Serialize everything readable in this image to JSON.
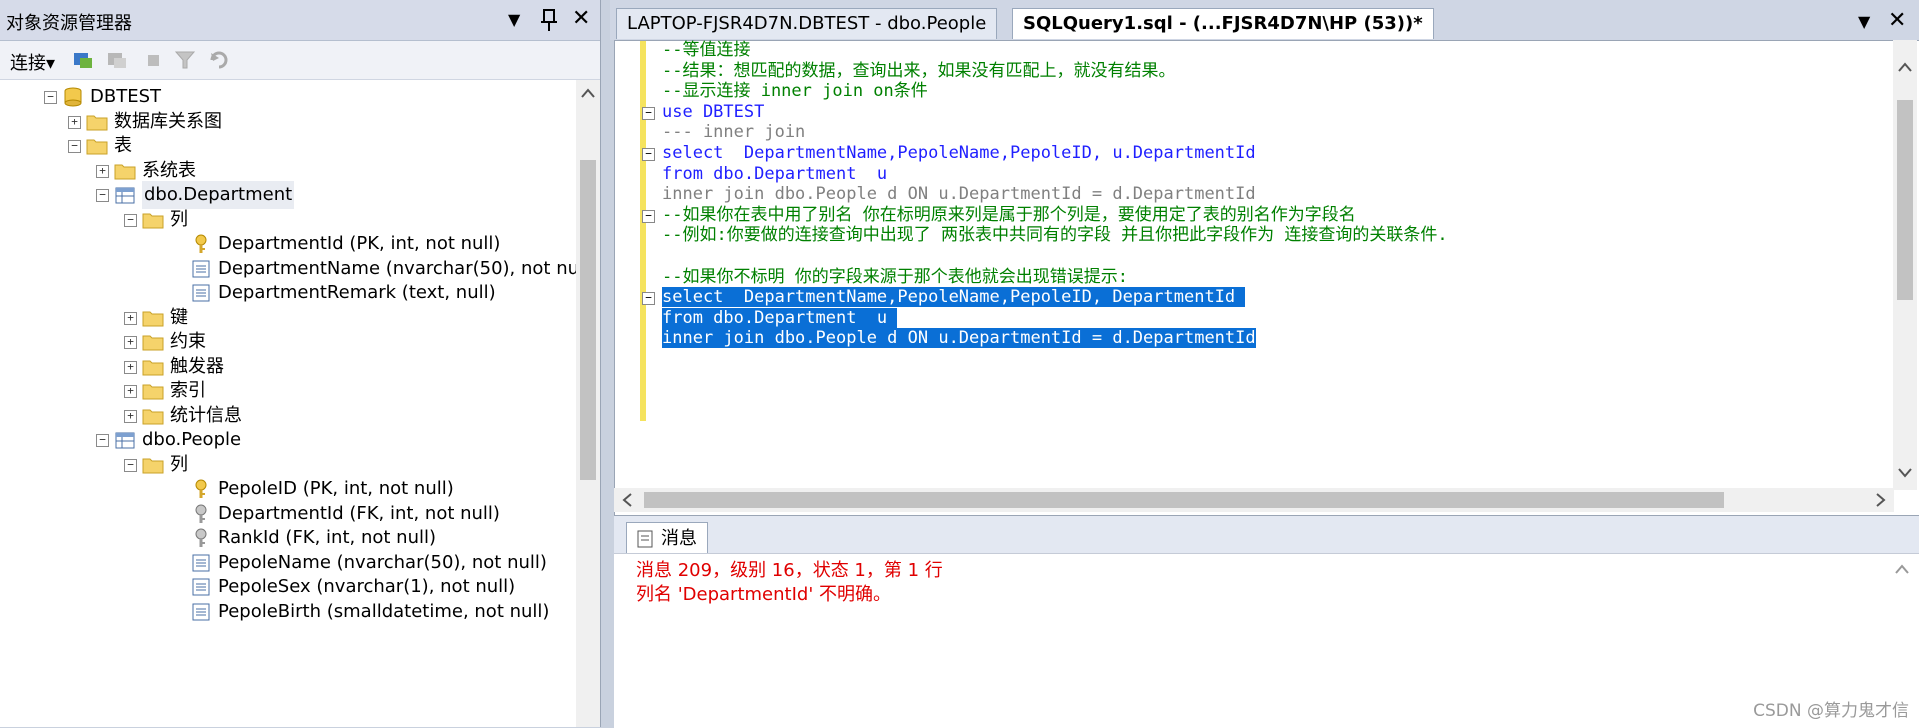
{
  "object_explorer": {
    "title": "对象资源管理器",
    "pin_glyph": "▼",
    "close_glyph": "✕",
    "toolbar": {
      "connect_label": "连接▾"
    },
    "tree": [
      {
        "label": "DBTEST",
        "expander": "−",
        "icon": "database-icon"
      },
      {
        "label": "数据库关系图",
        "expander": "+",
        "icon": "folder-icon"
      },
      {
        "label": "表",
        "expander": "−",
        "icon": "folder-icon"
      },
      {
        "label": "系统表",
        "expander": "+",
        "icon": "folder-icon"
      },
      {
        "label": "dbo.Department",
        "expander": "−",
        "icon": "table-icon"
      },
      {
        "label": "列",
        "expander": "−",
        "icon": "folder-icon"
      },
      {
        "label": "DepartmentId (PK, int, not null)",
        "expander": "",
        "icon": "key-icon"
      },
      {
        "label": "DepartmentName (nvarchar(50), not nu",
        "expander": "",
        "icon": "column-icon"
      },
      {
        "label": "DepartmentRemark (text, null)",
        "expander": "",
        "icon": "column-icon"
      },
      {
        "label": "键",
        "expander": "+",
        "icon": "folder-icon"
      },
      {
        "label": "约束",
        "expander": "+",
        "icon": "folder-icon"
      },
      {
        "label": "触发器",
        "expander": "+",
        "icon": "folder-icon"
      },
      {
        "label": "索引",
        "expander": "+",
        "icon": "folder-icon"
      },
      {
        "label": "统计信息",
        "expander": "+",
        "icon": "folder-icon"
      },
      {
        "label": "dbo.People",
        "expander": "−",
        "icon": "table-icon"
      },
      {
        "label": "列",
        "expander": "−",
        "icon": "folder-icon"
      },
      {
        "label": "PepoleID (PK, int, not null)",
        "expander": "",
        "icon": "key-icon"
      },
      {
        "label": "DepartmentId (FK, int, not null)",
        "expander": "",
        "icon": "fk-key-icon"
      },
      {
        "label": "RankId (FK, int, not null)",
        "expander": "",
        "icon": "fk-key-icon"
      },
      {
        "label": "PepoleName (nvarchar(50), not null)",
        "expander": "",
        "icon": "column-icon"
      },
      {
        "label": "PepoleSex (nvarchar(1), not null)",
        "expander": "",
        "icon": "column-icon"
      },
      {
        "label": "PepoleBirth (smalldatetime, not null)",
        "expander": "",
        "icon": "column-icon"
      }
    ]
  },
  "editor": {
    "tabs": [
      {
        "label": "LAPTOP-FJSR4D7N.DBTEST - dbo.People",
        "active": false
      },
      {
        "label": "SQLQuery1.sql - (...FJSR4D7N\\HP (53))*",
        "active": true
      }
    ],
    "tab_controls": {
      "dropdown": "▼",
      "close": "✕"
    },
    "lines": [
      "--等值连接",
      "--结果：想匹配的数据，查询出来，如果没有匹配上，就没有结果。",
      "--显示连接 inner join on条件",
      "use DBTEST",
      "--- inner join",
      "select  DepartmentName,PepoleName,PepoleID, u.DepartmentId",
      "from dbo.Department  u",
      "inner join dbo.People d ON u.DepartmentId = d.DepartmentId",
      "--如果你在表中用了别名 你在标明原来列是属于那个列是，要使用定了表的别名作为字段名",
      "--例如:你要做的连接查询中出现了 两张表中共同有的字段 并且你把此字段作为 连接查询的关联条件.",
      "",
      "--如果你不标明 你的字段来源于那个表他就会出现错误提示:",
      "select  DepartmentName,PepoleName,PepoleID, DepartmentId ",
      "from dbo.Department  u ",
      "inner join dbo.People d ON u.DepartmentId = d.DepartmentId"
    ]
  },
  "messages": {
    "tab_label": "消息",
    "lines": [
      "消息 209，级别 16，状态 1，第 1 行",
      "列名 'DepartmentId' 不明确。"
    ]
  },
  "watermark": "CSDN @算力鬼才信"
}
